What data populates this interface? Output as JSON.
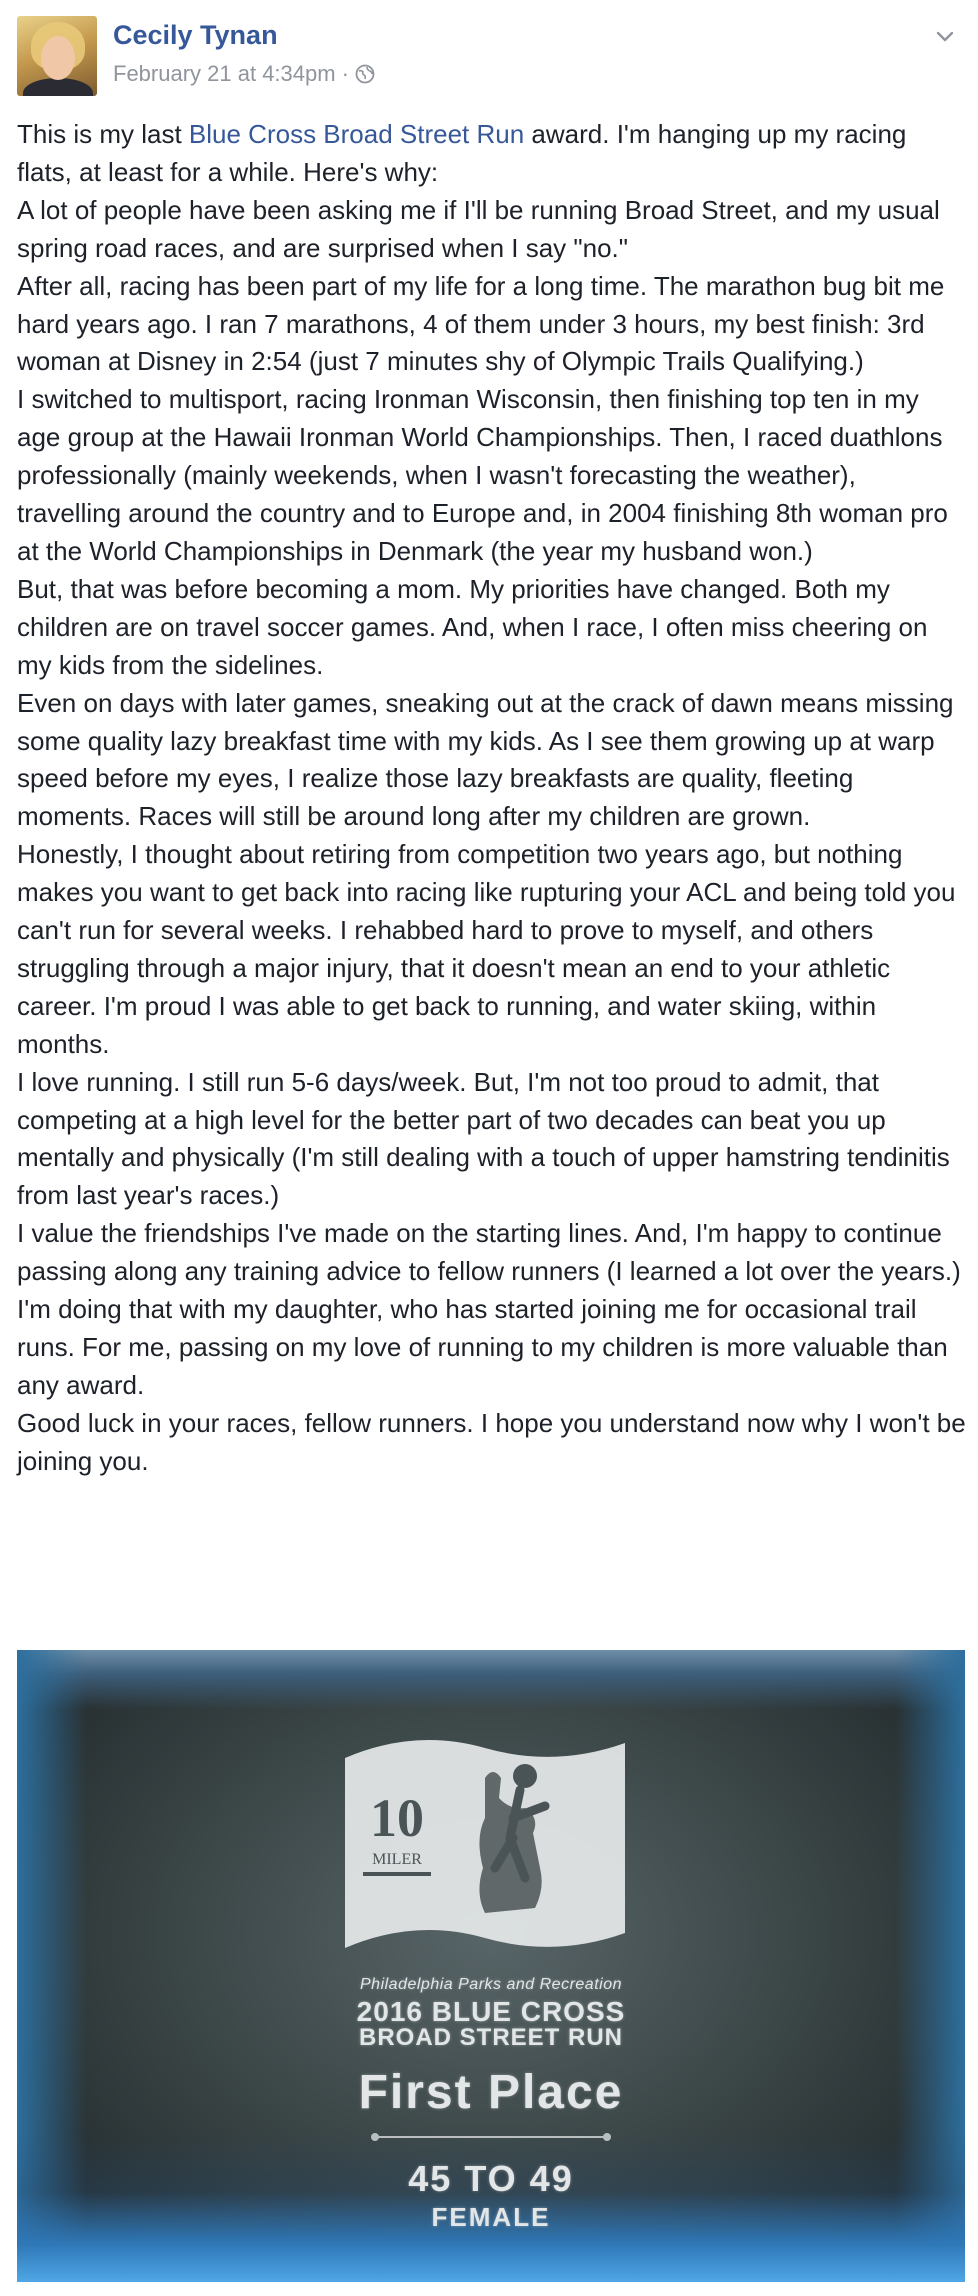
{
  "post": {
    "author": "Cecily Tynan",
    "timestamp": "February 21 at 4:34pm",
    "separator": "·",
    "privacy_icon": "globe-icon",
    "menu_icon": "chevron-down-icon",
    "intro_before_link": "This is my last ",
    "intro_link": "Blue Cross Broad Street Run",
    "intro_after_link": " award. I'm hanging up my racing flats, at least for a while. Here's why:",
    "paragraphs": [
      "A lot of people have been asking me if I'll be running Broad Street, and my usual spring road races, and are surprised when I say \"no.\"",
      "After all, racing has been part of my life for a long time. The marathon bug bit me hard years ago. I ran 7 marathons, 4 of them under 3 hours, my best finish: 3rd woman at Disney in 2:54 (just 7 minutes shy of Olympic Trails Qualifying.)",
      "I switched to multisport, racing Ironman Wisconsin, then finishing top ten in my age group at the Hawaii Ironman World Championships. Then, I raced duathlons professionally (mainly weekends, when I wasn't forecasting the weather), travelling around the country and to Europe and, in 2004 finishing 8th woman pro at the World Championships in Denmark (the year my husband won.)",
      "But, that was before becoming a mom. My priorities have changed. Both my children are on travel soccer games. And, when I race, I often miss cheering on my kids from the sidelines.",
      "Even on days with later games, sneaking out at the crack of dawn means missing some quality lazy breakfast time with my kids. As I see them growing up at warp speed before my eyes, I realize those lazy breakfasts are quality, fleeting moments. Races will still be around long after my children are grown.",
      "Honestly, I thought about retiring from competition two years ago, but nothing makes you want to get back into racing like rupturing your ACL and being told you can't run for several weeks. I rehabbed hard to prove to myself, and others struggling through a major injury, that it doesn't mean an end to your athletic career. I'm proud I was able to get back to running, and water skiing, within months.",
      "I love running. I still run 5-6 days/week. But, I'm not too proud to admit, that competing at a high level for the better part of two decades can beat you up mentally and physically (I'm still dealing with a touch of upper hamstring tendinitis from last year's races.)",
      "I value the friendships I've made on the starting lines. And, I'm happy to continue passing along any training advice to fellow runners (I learned a lot over the years.)",
      "I'm doing that with my daughter, who has started joining me for occasional trail runs. For me, passing on my love of running to my children is more valuable than any award.",
      "Good luck in your races, fellow runners. I hope you understand now why I won't be joining you."
    ]
  },
  "photo": {
    "logo_number": "10",
    "logo_word": "MILER",
    "sponsor_line": "Philadelphia Parks and Recreation",
    "race_line1": "2016 BLUE CROSS",
    "race_line2": "BROAD STREET RUN",
    "place": "First Place",
    "age_group": "45 TO 49",
    "gender": "FEMALE"
  },
  "colors": {
    "link": "#365899",
    "meta": "#90949c",
    "text": "#1d2129"
  }
}
